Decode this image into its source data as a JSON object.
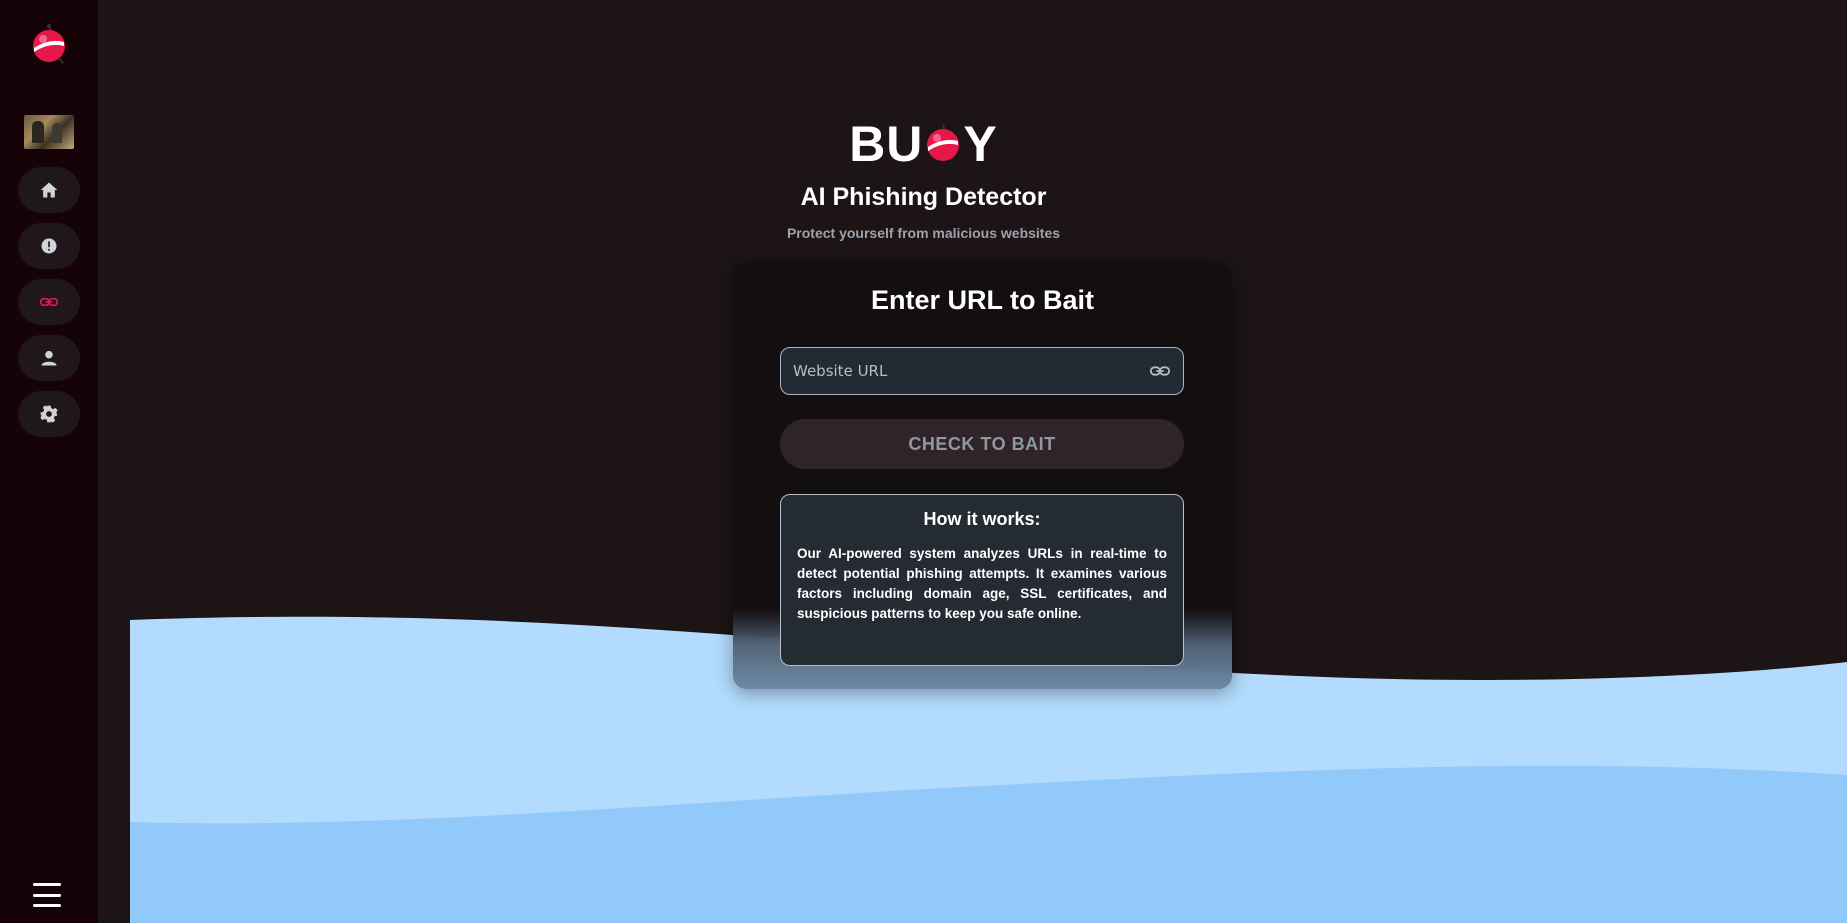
{
  "app": {
    "brand_left": "BU",
    "brand_right": "Y",
    "title": "AI Phishing Detector",
    "tagline": "Protect yourself from malicious websites"
  },
  "sidebar": {
    "items": [
      {
        "name": "home",
        "icon": "home-icon",
        "active": false
      },
      {
        "name": "alerts",
        "icon": "alert-icon",
        "active": false
      },
      {
        "name": "url-check",
        "icon": "link-icon",
        "active": true
      },
      {
        "name": "profile",
        "icon": "user-icon",
        "active": false
      },
      {
        "name": "settings",
        "icon": "gear-icon",
        "active": false
      }
    ],
    "menu_icon": "hamburger-icon"
  },
  "card": {
    "title": "Enter URL to Bait",
    "url_placeholder": "Website URL",
    "url_value": "",
    "check_button": "CHECK TO BAIT",
    "how_title": "How it works:",
    "how_text": "Our AI-powered system analyzes URLs in real-time to detect potential phishing attempts. It examines various factors including domain age, SSL certificates, and suspicious patterns to keep you safe online."
  },
  "colors": {
    "accent": "#e8174a",
    "background": "#1c1415",
    "sidebar": "#150307",
    "wave_light": "#b3dbfd",
    "wave_dark": "#92c9fb"
  }
}
